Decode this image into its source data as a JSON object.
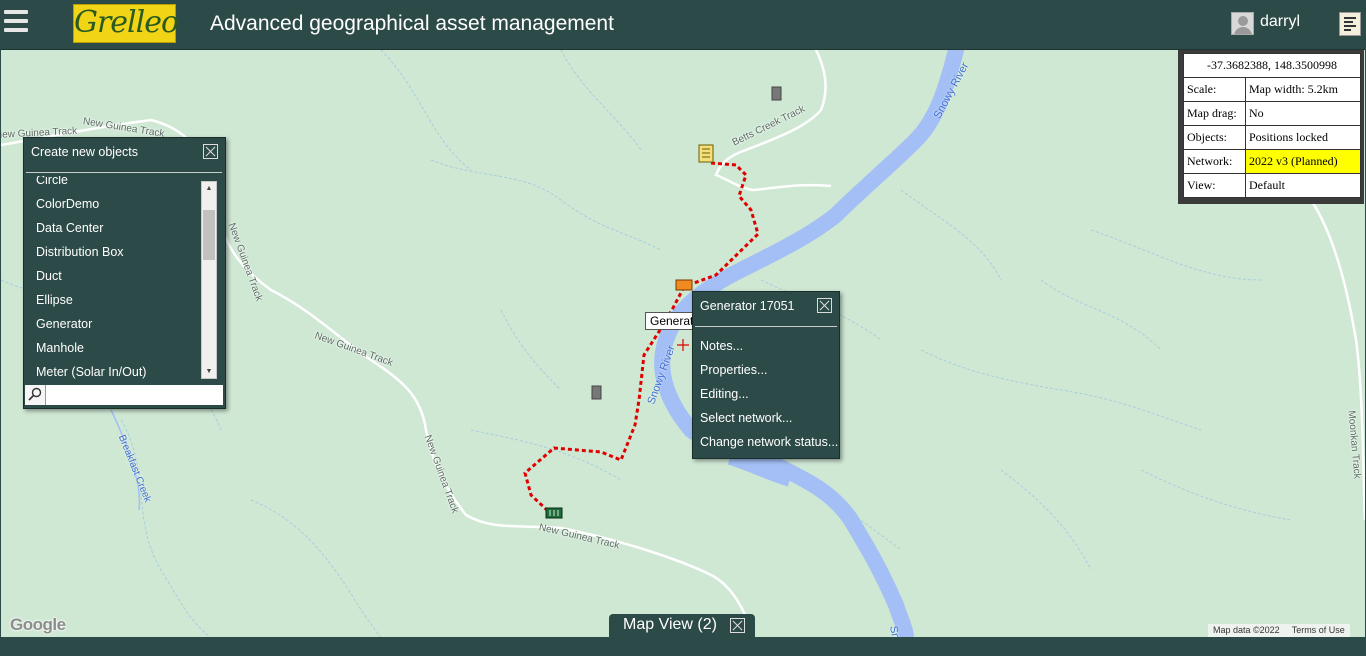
{
  "app": {
    "logo_text": "Grelleo",
    "title": "Advanced geographical asset management",
    "username": "darryl"
  },
  "info_panel": {
    "coordinates": "-37.3682388, 148.3500998",
    "rows": [
      {
        "label": "Scale:",
        "value": "Map width: 5.2km"
      },
      {
        "label": "Map drag:",
        "value": "No"
      },
      {
        "label": "Objects:",
        "value": "Positions locked"
      },
      {
        "label": "Network:",
        "value": "2022 v3 (Planned)"
      },
      {
        "label": "View:",
        "value": "Default"
      }
    ],
    "highlight_color": "#ffff00"
  },
  "create_panel": {
    "title": "Create new objects",
    "items": [
      "Circle",
      "ColorDemo",
      "Data Center",
      "Distribution Box",
      "Duct",
      "Ellipse",
      "Generator",
      "Manhole",
      "Meter (Solar In/Out)"
    ],
    "search_placeholder": ""
  },
  "context_menu": {
    "title": "Generator 17051",
    "items": [
      "Notes...",
      "Properties...",
      "Editing...",
      "Select network...",
      "Change network status..."
    ]
  },
  "tooltip_text": "Generator 17051",
  "map": {
    "road_labels": [
      "New Guinea Track",
      "New Guinea Track",
      "New Guinea Track",
      "New Guinea Track",
      "New Guinea Track",
      "New Guinea Track",
      "Betts Creek Track",
      "Moonkan Track"
    ],
    "water_labels": [
      "Snowy River",
      "Snowy River",
      "Snowy River"
    ],
    "creek_label": "Breakfast Creek",
    "google_text": "Google",
    "map_data": "Map data ©2022",
    "terms": "Terms of Use",
    "route_color": "#e00000",
    "river_color": "#a3bff5"
  },
  "map_tab": {
    "label": "Map View (2)"
  },
  "colors": {
    "chrome": "#2c4a47",
    "map_bg": "#cfe8d4",
    "logo_bg": "#f2d417"
  }
}
